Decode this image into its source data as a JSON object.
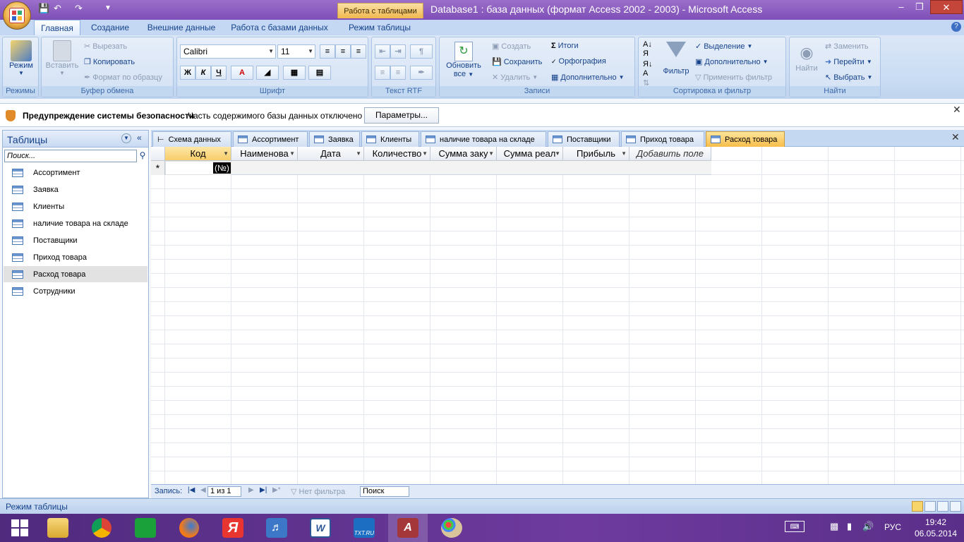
{
  "window": {
    "title": "Database1 : база данных (формат Access 2002 - 2003) - Microsoft Access",
    "context_tab": "Работа с таблицами"
  },
  "ribbon": {
    "tabs": [
      "Главная",
      "Создание",
      "Внешние данные",
      "Работа с базами данных",
      "Режим таблицы"
    ],
    "groups": {
      "modes": {
        "label": "Режимы",
        "mode_btn": "Режим"
      },
      "clipboard": {
        "label": "Буфер обмена",
        "paste": "Вставить",
        "cut": "Вырезать",
        "copy": "Копировать",
        "format_painter": "Формат по образцу"
      },
      "font": {
        "label": "Шрифт",
        "font_name": "Calibri",
        "font_size": "11",
        "bold": "Ж",
        "italic": "К",
        "underline": "Ч",
        "font_color": "A"
      },
      "rtf": {
        "label": "Текст RTF"
      },
      "records": {
        "label": "Записи",
        "refresh": "Обновить",
        "refresh_sub": "все",
        "new": "Создать",
        "save": "Сохранить",
        "delete": "Удалить",
        "totals": "Итоги",
        "spelling": "Орфография",
        "more": "Дополнительно"
      },
      "sort_filter": {
        "label": "Сортировка и фильтр",
        "filter": "Фильтр",
        "selection": "Выделение",
        "advanced": "Дополнительно",
        "toggle_filter": "Применить фильтр"
      },
      "find": {
        "label": "Найти",
        "find": "Найти",
        "replace": "Заменить",
        "goto": "Перейти",
        "select": "Выбрать"
      }
    }
  },
  "security": {
    "title": "Предупреждение системы безопасности",
    "message": "Часть содержимого базы данных отключено",
    "button": "Параметры..."
  },
  "nav": {
    "title": "Таблицы",
    "search_placeholder": "Поиск...",
    "items": [
      "Ассортимент",
      "Заявка",
      "Клиенты",
      "наличие товара на складе",
      "Поставщики",
      "Приход товара",
      "Расход товара",
      "Сотрудники"
    ],
    "selected_index": 6
  },
  "doc_tabs": [
    "Схема данных",
    "Ассортимент",
    "Заявка",
    "Клиенты",
    "наличие товара на складе",
    "Поставщики",
    "Приход товара",
    "Расход товара"
  ],
  "grid": {
    "columns": [
      "Код",
      "Наименова",
      "Дата",
      "Количество",
      "Сумма заку",
      "Сумма реал",
      "Прибыль"
    ],
    "add_field": "Добавить поле",
    "new_row_marker": "*",
    "autonumber": "(№)"
  },
  "record_nav": {
    "label": "Запись:",
    "position": "1 из 1",
    "filter": "Нет фильтра",
    "search": "Поиск"
  },
  "status": {
    "text": "Режим таблицы"
  },
  "taskbar": {
    "lang": "РУС",
    "time": "19:42",
    "date": "06.05.2014",
    "apps": [
      "start-icon",
      "explorer-icon",
      "chrome-icon",
      "store-icon",
      "firefox-icon",
      "yandex-icon",
      "audio-icon",
      "word-icon",
      "txtru-icon",
      "access-icon",
      "paint-icon"
    ]
  }
}
